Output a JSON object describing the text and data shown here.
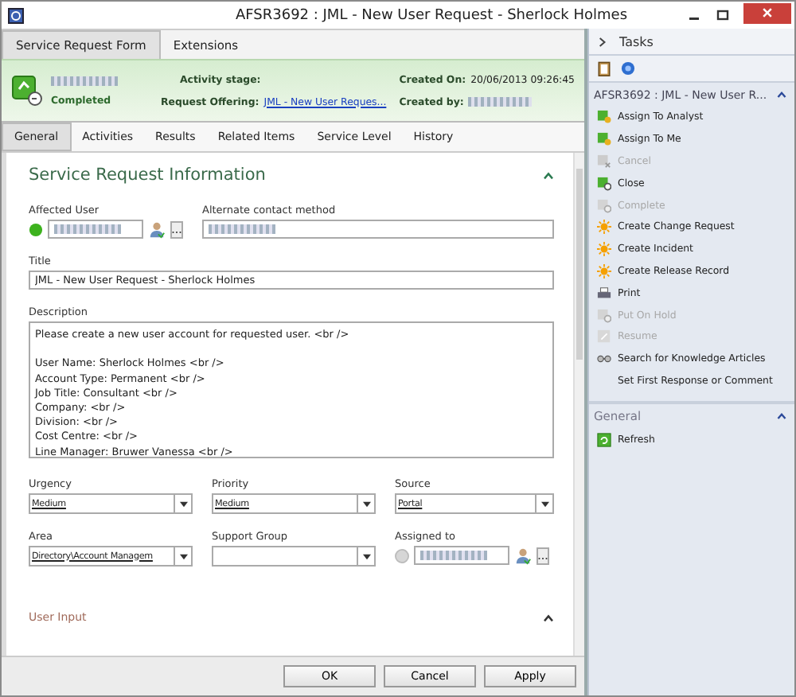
{
  "window": {
    "title": "AFSR3692 : JML - New User Request - Sherlock Holmes"
  },
  "form_tabs": [
    {
      "label": "Service Request Form",
      "selected": true
    },
    {
      "label": "Extensions",
      "selected": false
    }
  ],
  "header": {
    "status": "Completed",
    "activity_stage_label": "Activity stage:",
    "request_offering_label": "Request Offering:",
    "request_offering_link": "JML - New User Reques...",
    "created_on_label": "Created On:",
    "created_on": "20/06/2013 09:26:45",
    "created_by_label": "Created by:"
  },
  "sub_tabs": [
    {
      "label": "General",
      "selected": true
    },
    {
      "label": "Activities",
      "selected": false
    },
    {
      "label": "Results",
      "selected": false
    },
    {
      "label": "Related Items",
      "selected": false
    },
    {
      "label": "Service Level",
      "selected": false
    },
    {
      "label": "History",
      "selected": false
    }
  ],
  "section": {
    "title": "Service Request Information",
    "expanded": true
  },
  "affected_user": {
    "label": "Affected User"
  },
  "alternate_contact": {
    "label": "Alternate contact method"
  },
  "title_field": {
    "label": "Title",
    "value": "JML - New User Request - Sherlock Holmes"
  },
  "description": {
    "label": "Description",
    "paragraphs": [
      [
        "Please create a new user account for requested user. <br />"
      ],
      [
        "User Name: Sherlock Holmes <br />",
        "Account Type: Permanent <br />",
        "Job Title: Consultant <br />",
        "Company: <br />",
        "Division: <br />",
        "Cost Centre: <br />",
        "Line Manager:  Bruwer Vanessa <br />"
      ]
    ]
  },
  "dropdowns": [
    {
      "label": "Urgency",
      "value": "Medium"
    },
    {
      "label": "Priority",
      "value": "Medium"
    },
    {
      "label": "Source",
      "value": "Portal"
    },
    {
      "label": "Area",
      "value": "Directory\\Account Managem"
    },
    {
      "label": "Support Group"
    }
  ],
  "assigned_to": {
    "label": "Assigned to"
  },
  "next_section": {
    "title": "User Input"
  },
  "buttons": [
    "OK",
    "Cancel",
    "Apply"
  ],
  "tasks": {
    "title": "Tasks",
    "group": "AFSR3692 : JML - New User R...",
    "items": [
      {
        "label": "Assign To Analyst",
        "kind": "assign",
        "disabled": false
      },
      {
        "label": "Assign To Me",
        "kind": "assign",
        "disabled": false
      },
      {
        "label": "Cancel",
        "kind": "cancel",
        "disabled": true
      },
      {
        "label": "Close",
        "kind": "close",
        "disabled": false
      },
      {
        "label": "Complete",
        "kind": "complete",
        "disabled": true
      },
      {
        "label": "Create Change Request",
        "kind": "create",
        "disabled": false
      },
      {
        "label": "Create Incident",
        "kind": "create",
        "disabled": false
      },
      {
        "label": "Create Release Record",
        "kind": "create",
        "disabled": false
      },
      {
        "label": "Print",
        "kind": "print",
        "disabled": false
      },
      {
        "label": "Put On Hold",
        "kind": "complete",
        "disabled": true
      },
      {
        "label": "Resume",
        "kind": "resume",
        "disabled": true
      },
      {
        "label": "Search for Knowledge Articles",
        "kind": "search",
        "disabled": false
      },
      {
        "label": "Set First Response or Comment",
        "kind": "none",
        "disabled": false
      }
    ],
    "general": "General",
    "general_items": [
      {
        "label": "Refresh",
        "kind": "refresh",
        "disabled": false
      }
    ]
  }
}
